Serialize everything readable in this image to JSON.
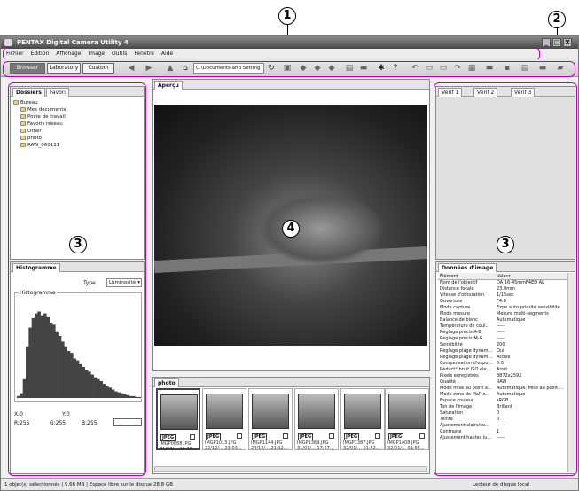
{
  "callouts": {
    "c1": "1",
    "c2": "2",
    "c3_left": "3",
    "c4": "4",
    "c3_right": "3"
  },
  "window": {
    "title": "PENTAX Digital Camera Utility 4",
    "controls": {
      "minimize": "_",
      "maximize": "□",
      "close": "X"
    }
  },
  "menu": [
    "Fichier",
    "Édition",
    "Affichage",
    "Image",
    "Outils",
    "Fenêtre",
    "Aide"
  ],
  "toolbar": {
    "modes": [
      "Browser",
      "Laboratory",
      "Custom"
    ],
    "path": "C:\\Documents and Setting"
  },
  "folders_panel": {
    "tabs": [
      "Dossiers",
      "Favori"
    ],
    "tree": [
      "Bureau",
      "Mes documents",
      "Poste de travail",
      "Favoris réseau",
      "Other",
      "photo",
      "RAW_060111"
    ]
  },
  "histogram_panel": {
    "tab": "Histogramme",
    "type_label": "Type",
    "type_value": "Luminosité",
    "group_label": "Histogramme",
    "x_label": "X:0",
    "y_label": "Y:0",
    "r": "R:255",
    "g": "G:255",
    "b": "B:255"
  },
  "preview_panel": {
    "tab": "Aperçu"
  },
  "thumbs_panel": {
    "tab": "photo",
    "items": [
      {
        "name": "IMGP0888.JPG",
        "date": "31/03/... 19:38...",
        "badge": "JPEG"
      },
      {
        "name": "IMGP1013.JPG",
        "date": "22/12/... 23:03...",
        "badge": "JPEG"
      },
      {
        "name": "IMGP1144.JPG",
        "date": "24/12/... 21:12...",
        "badge": "JPEG"
      },
      {
        "name": "IMGP1369.JPG",
        "date": "31/01/... 17:27...",
        "badge": "JPEG"
      },
      {
        "name": "IMGP1387.JPG",
        "date": "32/01/... 01:52...",
        "badge": "JPEG"
      },
      {
        "name": "IMGP1408.JPG",
        "date": "32/01/... 01:55...",
        "badge": "JPEG"
      }
    ]
  },
  "viewer_panel": {
    "tabs": [
      "Vérif 1",
      "Vérif 2",
      "Vérif 3"
    ]
  },
  "image_data_panel": {
    "tab": "Données d'image",
    "headers": [
      "Élément",
      "Valeur"
    ],
    "rows": [
      [
        "Nom de l'objectif",
        "DA 16-45mmF4ED AL"
      ],
      [
        "Distance focale",
        "23.0mm"
      ],
      [
        "Vitesse d'obturation",
        "1/15sec"
      ],
      [
        "Ouverture",
        "F4.0"
      ],
      [
        "Mode capture",
        "Expo auto priorité sensibilité"
      ],
      [
        "Mode mesure",
        "Mesure multi-segments"
      ],
      [
        "Balance de blanc",
        "Automatique"
      ],
      [
        "Température de coul...",
        "-----"
      ],
      [
        "Réglage précis A-B",
        "-----"
      ],
      [
        "Réglage précis M-G",
        "-----"
      ],
      [
        "Sensibilité",
        "200"
      ],
      [
        "Réglage plage dynam...",
        "Oui"
      ],
      [
        "Réglage plage dynam...",
        "Activé"
      ],
      [
        "Compensation d'expo...",
        "0.0"
      ],
      [
        "Réduct° bruit ISO éle...",
        "Arrêt"
      ],
      [
        "Pixels enregistrés",
        "3872x2592"
      ],
      [
        "Qualité",
        "RAW"
      ],
      [
        "Mode mise au point a...",
        "Automatique: Mise au point ..."
      ],
      [
        "Mode zone de MaP a...",
        "Automatique"
      ],
      [
        "Espace couleur",
        "sRGB"
      ],
      [
        "Ton de l'image",
        "Brillant"
      ],
      [
        "Saturation",
        "0"
      ],
      [
        "Teinte",
        "0"
      ],
      [
        "Ajustement clairs/so...",
        "-----"
      ],
      [
        "Contraste",
        "1"
      ],
      [
        "Ajustement hautes lu...",
        "-----"
      ]
    ]
  },
  "statusbar": {
    "left": "1 objet(s) sélectionnés | 9.66 MB | Espace libre sur le disque 28.8 GB",
    "right": "Lecteur de disque local"
  },
  "histogram": {
    "bins": [
      0.02,
      0.05,
      0.2,
      0.55,
      0.75,
      0.85,
      0.9,
      0.92,
      0.88,
      0.9,
      0.86,
      0.8,
      0.78,
      0.7,
      0.66,
      0.6,
      0.55,
      0.5,
      0.48,
      0.42,
      0.4,
      0.36,
      0.33,
      0.3,
      0.28,
      0.25,
      0.22,
      0.2,
      0.18,
      0.15,
      0.13,
      0.11,
      0.09,
      0.07,
      0.06,
      0.05,
      0.04,
      0.03,
      0.02,
      0.02,
      0.01,
      0.01
    ]
  }
}
